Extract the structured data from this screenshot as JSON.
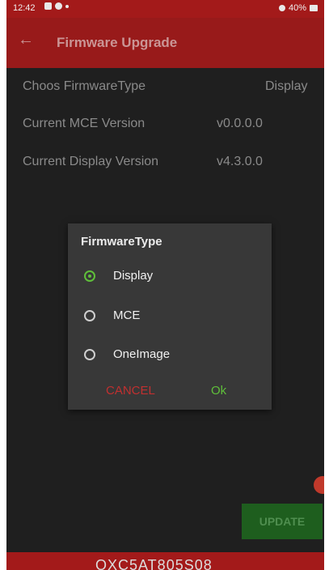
{
  "status_bar": {
    "time": "12:42",
    "battery": "40%"
  },
  "app_bar": {
    "back_icon": "arrow-left-icon",
    "title": "Firmware Upgrade"
  },
  "settings": {
    "firmware_type_label": "Choos FirmwareType",
    "firmware_type_value": "Display",
    "mce_version_label": "Current MCE Version",
    "mce_version_value": "v0.0.0.0",
    "display_version_label": "Current Display Version",
    "display_version_value": "v4.3.0.0"
  },
  "dialog": {
    "title": "FirmwareType",
    "options": [
      {
        "label": "Display",
        "selected": true
      },
      {
        "label": "MCE",
        "selected": false
      },
      {
        "label": "OneImage",
        "selected": false
      }
    ],
    "cancel_label": "CANCEL",
    "ok_label": "Ok"
  },
  "update_button": {
    "label": "UPDATE"
  },
  "bottom_bar": {
    "serial": "OXC5AT805S08"
  },
  "colors": {
    "brand_red": "#a31a1a",
    "accent_green": "#5fbf3a",
    "cancel_red": "#c03030"
  }
}
